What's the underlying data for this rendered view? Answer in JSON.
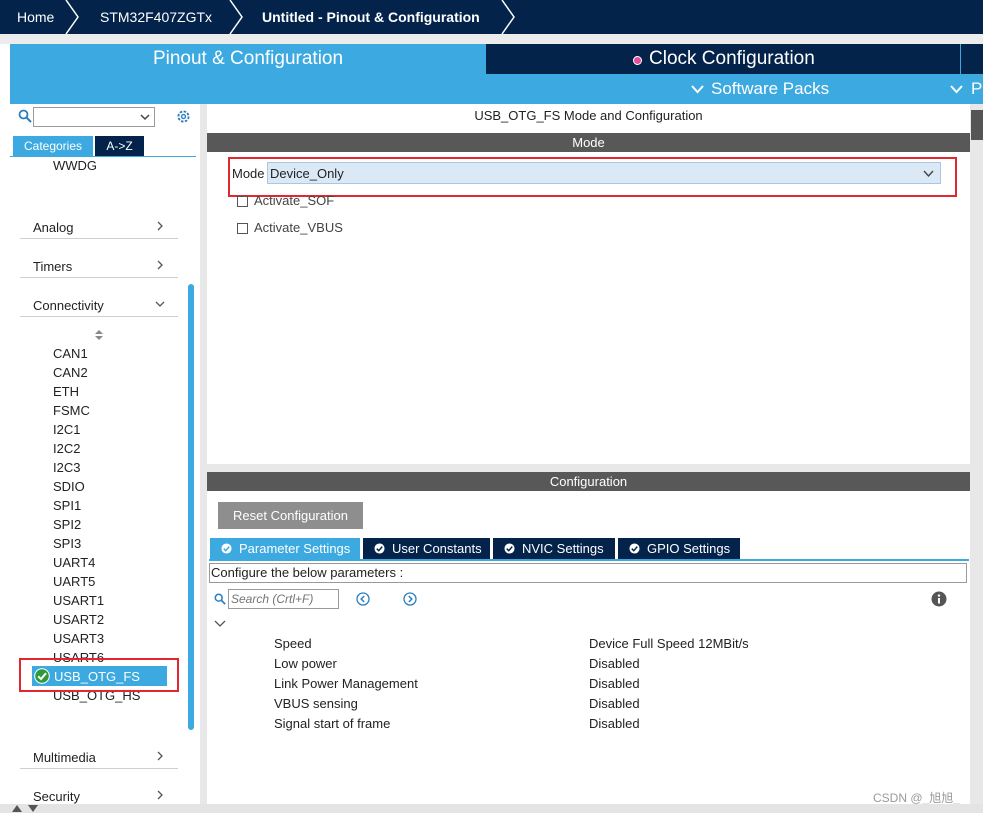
{
  "breadcrumb": {
    "home": "Home",
    "device": "STM32F407ZGTx",
    "current": "Untitled - Pinout & Configuration"
  },
  "tabs": {
    "pinout": "Pinout & Configuration",
    "clock": "Clock Configuration",
    "software_packs": "Software Packs",
    "right_partial": "P"
  },
  "sidebar": {
    "category_tabs": [
      "Categories",
      "A->Z"
    ],
    "top_item": "WWDG",
    "categories": [
      "Analog",
      "Timers",
      "Connectivity",
      "Multimedia",
      "Security"
    ],
    "connectivity_items": [
      "CAN1",
      "CAN2",
      "ETH",
      "FSMC",
      "I2C1",
      "I2C2",
      "I2C3",
      "SDIO",
      "SPI1",
      "SPI2",
      "SPI3",
      "UART4",
      "UART5",
      "USART1",
      "USART2",
      "USART3",
      "USART6",
      "USB_OTG_FS",
      "USB_OTG_HS"
    ],
    "selected": "USB_OTG_FS"
  },
  "mode": {
    "title": "USB_OTG_FS Mode and Configuration",
    "section": "Mode",
    "mode_label": "Mode",
    "mode_value": "Device_Only",
    "activate_sof": "Activate_SOF",
    "activate_vbus": "Activate_VBUS"
  },
  "configuration": {
    "section": "Configuration",
    "reset_label": "Reset Configuration",
    "tabs": [
      "Parameter Settings",
      "User Constants",
      "NVIC Settings",
      "GPIO Settings"
    ],
    "configure_text": "Configure the below parameters :",
    "search_placeholder": "Search (Crtl+F)",
    "params": [
      {
        "name": "Speed",
        "value": "Device Full Speed 12MBit/s"
      },
      {
        "name": "Low power",
        "value": "Disabled"
      },
      {
        "name": "Link Power Management",
        "value": "Disabled"
      },
      {
        "name": "VBUS sensing",
        "value": "Disabled"
      },
      {
        "name": "Signal start of frame",
        "value": "Disabled"
      }
    ]
  },
  "watermark": "CSDN @_旭旭_",
  "colors": {
    "navy": "#03234b",
    "accent": "#3caae0",
    "highlight_box": "#e0282e"
  }
}
